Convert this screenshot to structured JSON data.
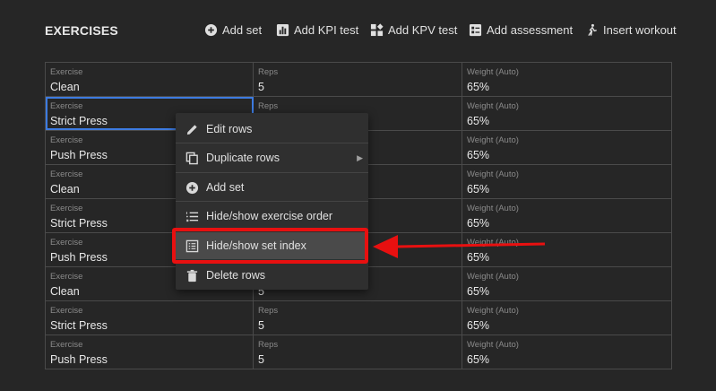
{
  "section": {
    "title": "EXERCISES"
  },
  "toolbar": {
    "add_set": "Add set",
    "add_kpi": "Add KPI test",
    "add_kpv": "Add KPV test",
    "add_assessment": "Add assessment",
    "insert_workout": "Insert workout"
  },
  "grid": {
    "headers": {
      "exercise": "Exercise",
      "reps": "Reps",
      "weight": "Weight (Auto)"
    },
    "rows": [
      {
        "exercise": "Clean",
        "reps": "5",
        "weight": "65%"
      },
      {
        "exercise": "Strict Press",
        "reps": "",
        "weight": "65%"
      },
      {
        "exercise": "Push Press",
        "reps": "",
        "weight": "65%"
      },
      {
        "exercise": "Clean",
        "reps": "",
        "weight": "65%"
      },
      {
        "exercise": "Strict Press",
        "reps": "",
        "weight": "65%"
      },
      {
        "exercise": "Push Press",
        "reps": "",
        "weight": "65%"
      },
      {
        "exercise": "Clean",
        "reps": "5",
        "weight": "65%"
      },
      {
        "exercise": "Strict Press",
        "reps": "5",
        "weight": "65%"
      },
      {
        "exercise": "Push Press",
        "reps": "5",
        "weight": "65%"
      }
    ]
  },
  "context_menu": {
    "edit_rows": "Edit rows",
    "duplicate_rows": "Duplicate rows",
    "add_set": "Add set",
    "toggle_order": "Hide/show exercise order",
    "toggle_set_index": "Hide/show set index",
    "delete_rows": "Delete rows"
  },
  "colors": {
    "highlight": "#e81010",
    "selection": "#3d7be0",
    "background": "#262626"
  }
}
